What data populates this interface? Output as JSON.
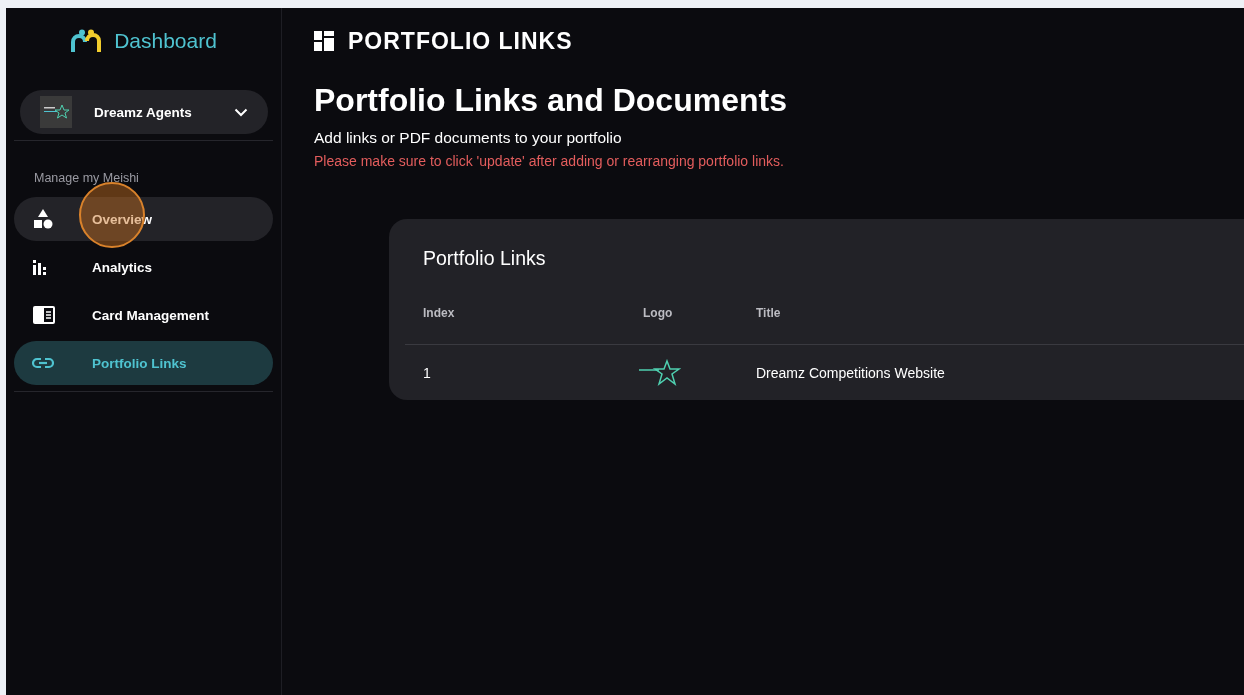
{
  "sidebar": {
    "logo_text": "Dashboard",
    "account": {
      "name": "Dreamz Agents"
    },
    "section_label": "Manage my Meishi",
    "items": [
      {
        "label": "Overview",
        "selected": false,
        "hovered": true
      },
      {
        "label": "Analytics",
        "selected": false,
        "hovered": false
      },
      {
        "label": "Card Management",
        "selected": false,
        "hovered": false
      },
      {
        "label": "Portfolio Links",
        "selected": true,
        "hovered": false
      }
    ]
  },
  "header": {
    "title": "PORTFOLIO LINKS"
  },
  "page": {
    "heading": "Portfolio Links and Documents",
    "subtitle": "Add links or PDF documents to your portfolio",
    "warning": "Please make sure to click 'update' after adding or rearranging portfolio links."
  },
  "table": {
    "title": "Portfolio Links",
    "columns": [
      "Index",
      "Logo",
      "Title"
    ],
    "rows": [
      {
        "index": "1",
        "title": "Dreamz Competitions Website"
      }
    ]
  }
}
